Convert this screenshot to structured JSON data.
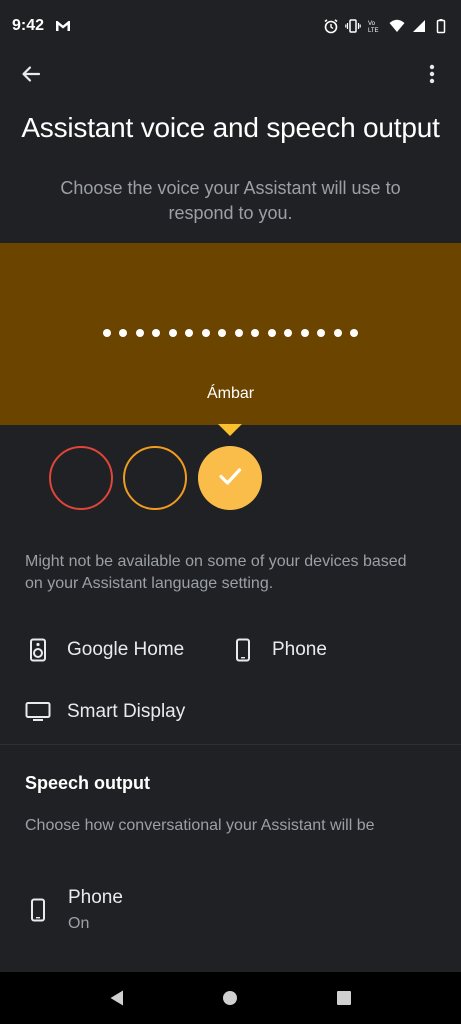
{
  "status_bar": {
    "time": "9:42",
    "left_icons": [
      "gmail-icon"
    ],
    "right_icons": [
      "alarm-icon",
      "vibrate-icon",
      "volte-icon",
      "wifi-icon",
      "signal-icon",
      "battery-icon"
    ]
  },
  "app_bar": {
    "back_icon": "arrow-back-icon",
    "menu_icon": "more-vert-icon"
  },
  "page": {
    "title": "Assistant voice and speech output",
    "subtitle": "Choose the voice your Assistant will use to respond to you."
  },
  "voice_preview": {
    "name": "Ámbar",
    "dot_count": 16,
    "banner_color": "#6b4400"
  },
  "voices": [
    {
      "color": "#e0453a",
      "selected": false
    },
    {
      "color": "#f29c1f",
      "selected": false
    },
    {
      "color": "#fbbd4a",
      "selected": true
    }
  ],
  "availability_note": "Might not be available on some of your devices based on your Assistant language setting.",
  "devices": [
    {
      "label": "Google Home",
      "icon": "speaker-icon"
    },
    {
      "label": "Phone",
      "icon": "phone-icon"
    },
    {
      "label": "Smart Display",
      "icon": "display-icon"
    }
  ],
  "speech_output": {
    "title": "Speech output",
    "subtitle": "Choose how conversational your Assistant will be",
    "items": [
      {
        "title": "Phone",
        "state": "On",
        "icon": "phone-icon"
      }
    ]
  },
  "nav_bar": {
    "icons": [
      "back-triangle-icon",
      "home-circle-icon",
      "recents-square-icon"
    ]
  }
}
